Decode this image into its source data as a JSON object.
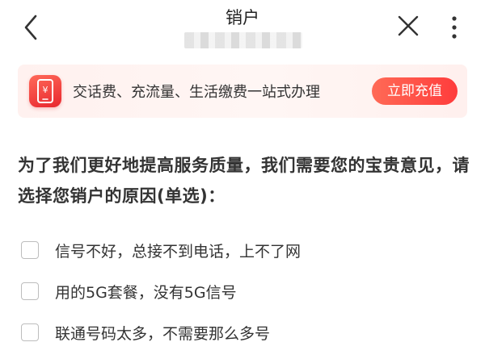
{
  "header": {
    "title": "销户"
  },
  "banner": {
    "text": "交话费、充流量、生活缴费一站式办理",
    "button_label": "立即充值",
    "icon": "phone-yuan-icon",
    "accent_color": "#ff4a45"
  },
  "survey": {
    "question": "为了我们更好地提高服务质量，我们需要您的宝贵意见，请选择您销户的原因(单选)：",
    "options": [
      {
        "label": "信号不好，总接不到电话，上不了网",
        "checked": false
      },
      {
        "label": "用的5G套餐，没有5G信号",
        "checked": false
      },
      {
        "label": "联通号码太多，不需要那么多号",
        "checked": false
      }
    ]
  }
}
